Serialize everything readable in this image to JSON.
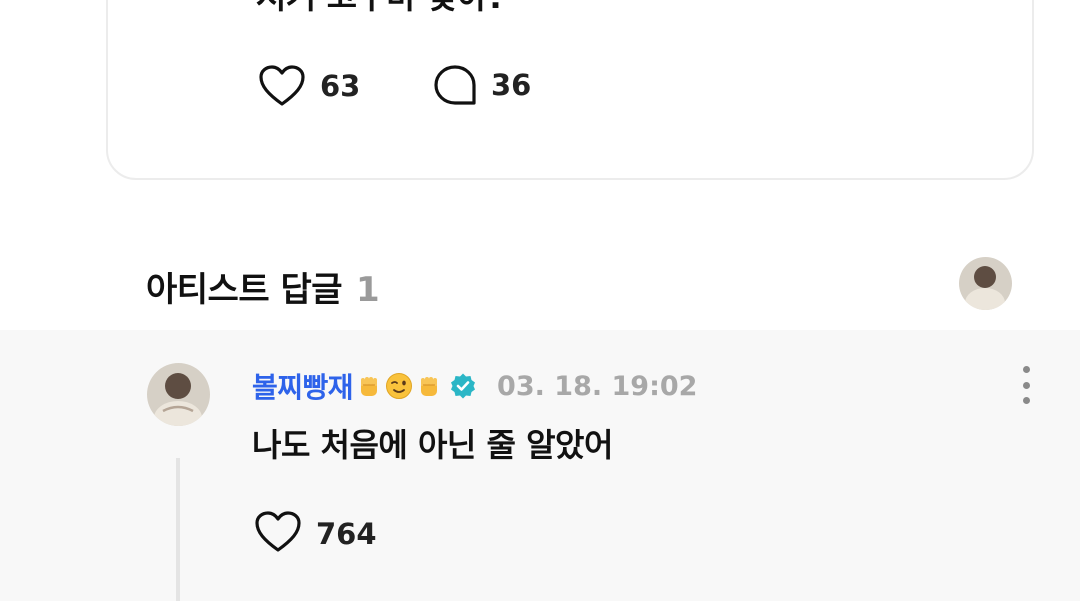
{
  "post": {
    "text": "저거 고구마 맞아?",
    "like_count": "63",
    "comment_count": "36"
  },
  "artist_replies": {
    "title": "아티스트 답글",
    "count": "1"
  },
  "reply": {
    "author": "볼찌빵재",
    "emojis": [
      "raised-fist",
      "winking-face",
      "raised-fist"
    ],
    "timestamp": "03. 18. 19:02",
    "text": "나도 처음에 아닌 줄 알았어",
    "like_count": "764"
  },
  "colors": {
    "author_name": "#2e63ea",
    "verified_badge": "#2bb6c6",
    "timestamp": "#a8a8a8",
    "reply_background": "#f8f8f8",
    "count_muted": "#9a9a9a"
  },
  "icons": {
    "like": "heart-icon",
    "comment": "speech-bubble-icon",
    "verified": "verified-badge-icon",
    "more": "more-vertical-icon"
  }
}
